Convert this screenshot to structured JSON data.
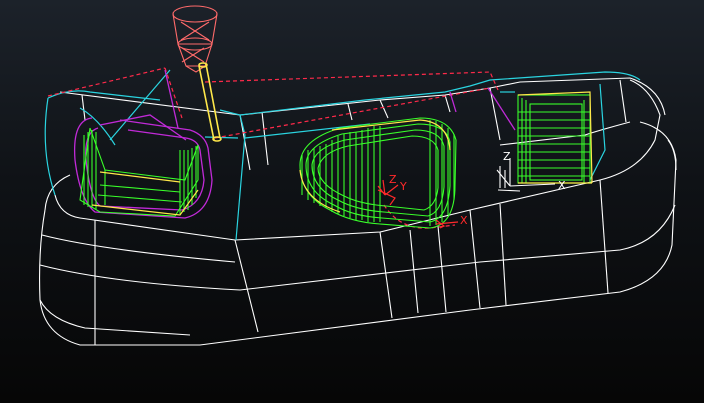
{
  "viewport": {
    "background_top": "#1c222a",
    "background_bottom": "#060606"
  },
  "colors": {
    "stock_wireframe": "#ffffff",
    "part_boundary": "#2ad4e0",
    "toolpath": "#39ff2a",
    "rapid_moves": "#ff2a4a",
    "leads_links": "#c12ad8",
    "tool": "#ff6a6a",
    "tool_shank": "#ffe84a",
    "world_axes": "#ff2a2a",
    "workplane_axes": "#ffffff"
  },
  "workplane_axes": {
    "z": "Z",
    "x": "X"
  },
  "world_axes": {
    "z": "Z",
    "y": "Y",
    "x": "X"
  },
  "icons": [
    "tool-icon",
    "workplane-triad-icon",
    "world-triad-icon"
  ]
}
